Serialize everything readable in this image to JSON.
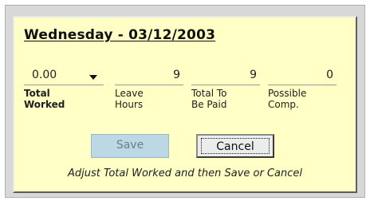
{
  "dialog": {
    "date_heading": "Wednesday - 03/12/2003"
  },
  "columns": [
    {
      "value": "0.00",
      "label_line1": "Total",
      "label_line2": "Worked",
      "control": "dropdown",
      "icon": "chevron-down-icon"
    },
    {
      "value": "9",
      "label_line1": "Leave",
      "label_line2": "Hours"
    },
    {
      "value": "9",
      "label_line1": "Total To",
      "label_line2": "Be Paid"
    },
    {
      "value": "0",
      "label_line1": "Possible",
      "label_line2": "Comp."
    }
  ],
  "buttons": {
    "save_label": "Save",
    "cancel_label": "Cancel"
  },
  "hint": "Adjust Total Worked and then Save or Cancel",
  "colors": {
    "dialog_background": "#ffffc6",
    "save_button": "#bcd8e4",
    "cancel_button": "#ececec"
  }
}
